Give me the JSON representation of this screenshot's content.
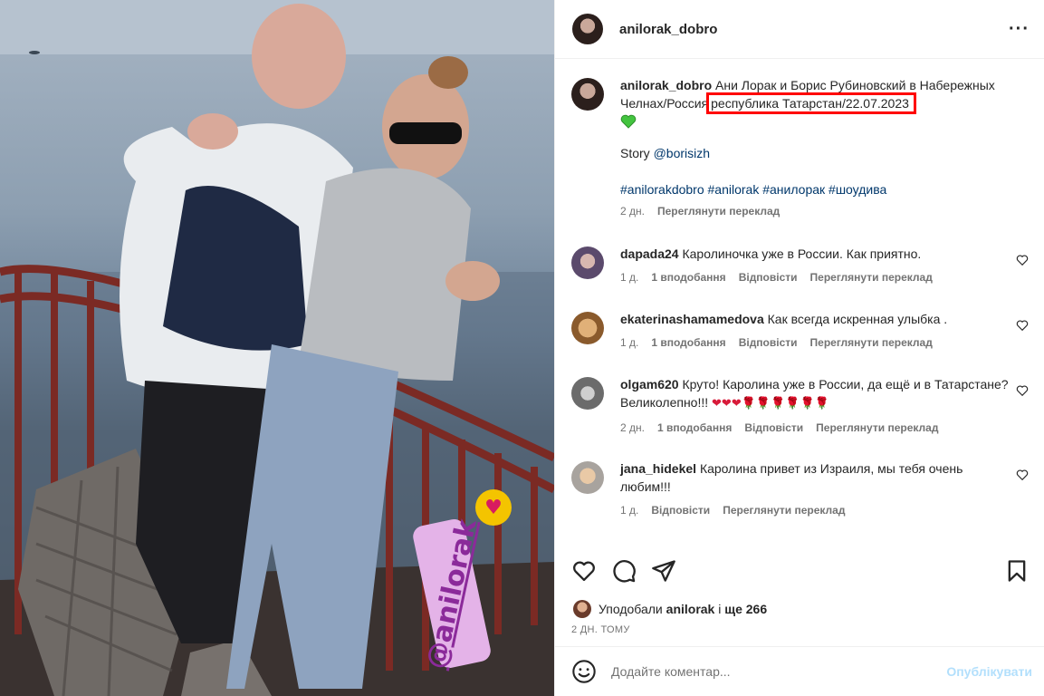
{
  "header": {
    "username": "anilorak_dobro",
    "more_icon": "more-horizontal-icon"
  },
  "caption": {
    "username": "anilorak_dobro",
    "text_part1": "Ани Лорак и Борис Рубиновский в Набережных Челнах/Россия",
    "text_highlight": "республика Татарстан/22.07.2023",
    "emoji": "green-heart",
    "story_label": "Story",
    "story_mention": "@borisizh",
    "hashtags": "#anilorakdobro #anilorak #анилорак #шоудива",
    "time": "2 дн.",
    "translate": "Переглянути переклад"
  },
  "comments": [
    {
      "username": "dapada24",
      "text": "Каролиночка уже в России. Как приятно.",
      "time": "1 д.",
      "likes": "1 вподобання",
      "reply": "Відповісти",
      "translate": "Переглянути переклад"
    },
    {
      "username": "ekaterinashamamedova",
      "text": "Как всегда искренная улыбка .",
      "time": "1 д.",
      "likes": "1 вподобання",
      "reply": "Відповісти",
      "translate": "Переглянути переклад"
    },
    {
      "username": "olgam620",
      "text": "Круто! Каролина уже в России, да ещё и в Татарстане? Великолепно!!!",
      "emojis": "❤❤❤🌹🌹🌹🌹🌹🌹",
      "time": "2 дн.",
      "likes": "1 вподобання",
      "reply": "Відповісти",
      "translate": "Переглянути переклад"
    },
    {
      "username": "jana_hidekel",
      "text": "Каролина привет из Израиля, мы тебя очень любим!!!",
      "time": "1 д.",
      "reply": "Відповісти",
      "translate": "Переглянути переклад"
    }
  ],
  "likes_bar": {
    "prefix": "Уподобали",
    "user": "anilorak",
    "middle": "і",
    "count": "ще 266"
  },
  "post_date": "2 ДН. ТОМУ",
  "add_comment": {
    "placeholder": "Додайте коментар...",
    "publish": "Опублікувати"
  },
  "sticker": {
    "mention": "@anilorak"
  },
  "colors": {
    "highlight_box": "#ff0000",
    "link": "#00376b",
    "muted": "#737373",
    "publish_disabled": "#b2dffc",
    "sticker_bg": "#e4b3e8",
    "sticker_text": "#8b2a9a"
  }
}
